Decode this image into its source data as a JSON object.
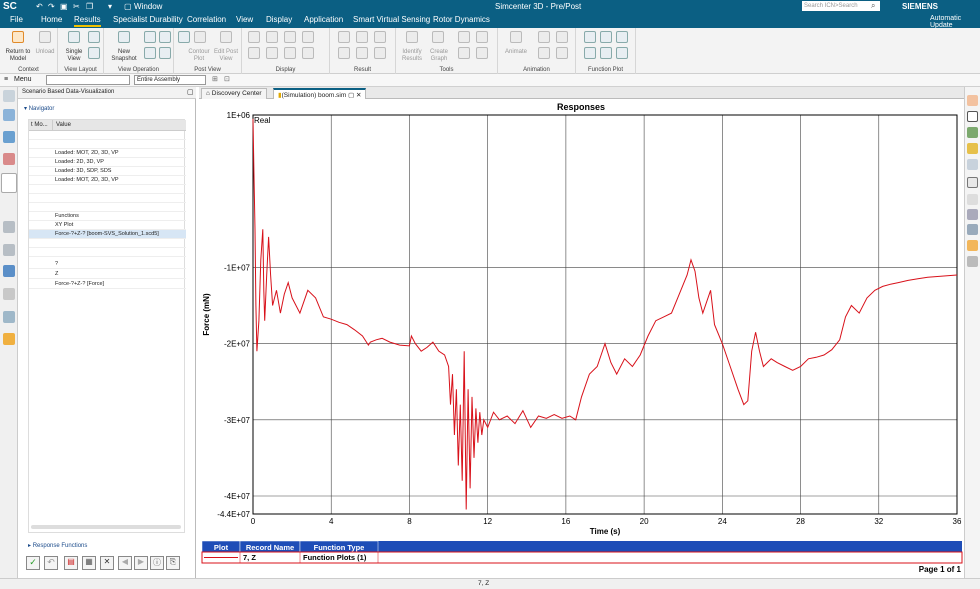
{
  "titlebar": {
    "app_logo": "SC",
    "window_menu": "Window",
    "title": "Simcenter 3D - Pre/Post",
    "search_placeholder": "Search ICN>Search",
    "brand": "SIEMENS",
    "update": "Automatic Update"
  },
  "menubar": {
    "items": [
      "File",
      "Home",
      "Results",
      "Specialist Durability",
      "Correlation",
      "View",
      "Display",
      "Application",
      "Smart Virtual Sensing",
      "Rotor Dynamics"
    ]
  },
  "ribbon": {
    "groups": [
      {
        "label": "Context",
        "buttons": [
          "Return to Model",
          "Unload"
        ]
      },
      {
        "label": "View Layout",
        "buttons": [
          "Single View"
        ]
      },
      {
        "label": "View Operation",
        "buttons": [
          "New Snapshot"
        ]
      },
      {
        "label": "Post View",
        "buttons": [
          "Contour Plot",
          "Edit Post View"
        ]
      },
      {
        "label": "Display",
        "buttons": []
      },
      {
        "label": "Result",
        "buttons": []
      },
      {
        "label": "Tools",
        "buttons": [
          "Identify Results",
          "Create Graph"
        ]
      },
      {
        "label": "Animation",
        "buttons": [
          "Animate"
        ]
      },
      {
        "label": "Function Plot",
        "buttons": []
      }
    ]
  },
  "toolbar2": {
    "menu_label": "Menu",
    "filter_value": "",
    "assembly_value": "Entire Assembly"
  },
  "navigator": {
    "panel_title": "Scenario Based Data-Visualization",
    "section": "Navigator",
    "col1": "t Mo...",
    "col2": "Value",
    "rows": [
      "",
      "",
      "Loaded: MOT, 2D, 3D, VP",
      "Loaded: 2D, 3D, VP",
      "Loaded: 3D, SDP, SDS",
      "Loaded: MOT, 2D, 3D, VP",
      "",
      "",
      "",
      "Functions",
      "XY Plot",
      "Force-?+Z-? [boom-SVS_Solution_1.scd5]",
      "",
      "",
      "?",
      "Z",
      "Force-?+Z-? [Force]"
    ],
    "selected_index": 11,
    "response_functions": "Response Functions"
  },
  "tabs": {
    "discovery": "Discovery Center",
    "sim": "(Simulation) boom.sim"
  },
  "chart_data": {
    "type": "line",
    "title": "Responses",
    "annotation": "Real",
    "xlabel": "Time (s)",
    "ylabel": "Force (mN)",
    "xlim": [
      0,
      36
    ],
    "ylim": [
      -44000000,
      10000000
    ],
    "xticks": [
      0,
      4,
      8,
      12,
      16,
      20,
      24,
      28,
      32,
      36
    ],
    "xtick_labels": [
      "0",
      "4",
      "8",
      "12",
      "16",
      "20",
      "24",
      "28",
      "32",
      "36"
    ],
    "yticks": [
      10000000,
      -10000000,
      -20000000,
      -30000000,
      -40000000,
      -44000000
    ],
    "ytick_labels": [
      "1E+06",
      "-1E+07",
      "-2E+07",
      "-3E+07",
      "-4E+07",
      "-4.4E+07"
    ],
    "grid": true,
    "series_color": "#d8111a",
    "series": [
      {
        "name": "7, Z",
        "points": [
          [
            0,
            9500000
          ],
          [
            0.05,
            2000000
          ],
          [
            0.1,
            -5000000
          ],
          [
            0.15,
            -15000000
          ],
          [
            0.2,
            -21000000
          ],
          [
            0.3,
            -17000000
          ],
          [
            0.4,
            -9000000
          ],
          [
            0.5,
            -5000000
          ],
          [
            0.55,
            -13000000
          ],
          [
            0.6,
            -17000000
          ],
          [
            0.7,
            -11000000
          ],
          [
            0.8,
            -6000000
          ],
          [
            0.9,
            -11000000
          ],
          [
            1.0,
            -15000000
          ],
          [
            1.2,
            -13000000
          ],
          [
            1.4,
            -16000000
          ],
          [
            1.6,
            -13500000
          ],
          [
            1.8,
            -12000000
          ],
          [
            2.0,
            -14000000
          ],
          [
            2.4,
            -16000000
          ],
          [
            2.8,
            -13000000
          ],
          [
            3.2,
            -14000000
          ],
          [
            3.6,
            -16500000
          ],
          [
            4.0,
            -16800000
          ],
          [
            4.4,
            -17200000
          ],
          [
            4.8,
            -17500000
          ],
          [
            5.2,
            -18200000
          ],
          [
            5.6,
            -19000000
          ],
          [
            5.9,
            -20200000
          ],
          [
            6.0,
            -19800000
          ],
          [
            6.3,
            -19500000
          ],
          [
            6.6,
            -19300000
          ],
          [
            7.0,
            -19800000
          ],
          [
            7.5,
            -20200000
          ],
          [
            8.0,
            -20300000
          ],
          [
            8.1,
            -19000000
          ],
          [
            8.3,
            -20000000
          ],
          [
            8.6,
            -21000000
          ],
          [
            8.9,
            -20500000
          ],
          [
            9.2,
            -19800000
          ],
          [
            9.5,
            -21000000
          ],
          [
            9.8,
            -21500000
          ],
          [
            10.0,
            -23000000
          ],
          [
            10.1,
            -28000000
          ],
          [
            10.2,
            -24000000
          ],
          [
            10.3,
            -32000000
          ],
          [
            10.4,
            -26000000
          ],
          [
            10.5,
            -36000000
          ],
          [
            10.6,
            -28000000
          ],
          [
            10.7,
            -38000000
          ],
          [
            10.8,
            -21000000
          ],
          [
            10.9,
            -43000000
          ],
          [
            11.0,
            -26000000
          ],
          [
            11.1,
            -39000000
          ],
          [
            11.2,
            -27000000
          ],
          [
            11.3,
            -35000000
          ],
          [
            11.4,
            -28500000
          ],
          [
            11.5,
            -33000000
          ],
          [
            11.6,
            -29000000
          ],
          [
            11.7,
            -32000000
          ],
          [
            11.8,
            -30000000
          ],
          [
            12.0,
            -31000000
          ],
          [
            12.3,
            -29000000
          ],
          [
            12.6,
            -30000000
          ],
          [
            13.0,
            -29500000
          ],
          [
            13.4,
            -30500000
          ],
          [
            13.8,
            -28800000
          ],
          [
            14.2,
            -31000000
          ],
          [
            14.6,
            -29500000
          ],
          [
            15.0,
            -29800000
          ],
          [
            15.4,
            -29300000
          ],
          [
            15.8,
            -29800000
          ],
          [
            16.2,
            -29500000
          ],
          [
            16.5,
            -30000000
          ],
          [
            16.8,
            -27000000
          ],
          [
            17.2,
            -24000000
          ],
          [
            17.6,
            -23000000
          ],
          [
            18.0,
            -20000000
          ],
          [
            18.3,
            -22500000
          ],
          [
            18.6,
            -24000000
          ],
          [
            19.0,
            -22000000
          ],
          [
            19.4,
            -23000000
          ],
          [
            19.8,
            -21500000
          ],
          [
            20.2,
            -19000000
          ],
          [
            20.6,
            -17000000
          ],
          [
            21.0,
            -16500000
          ],
          [
            21.4,
            -16000000
          ],
          [
            21.8,
            -13500000
          ],
          [
            22.2,
            -11000000
          ],
          [
            22.4,
            -9000000
          ],
          [
            22.6,
            -10500000
          ],
          [
            22.8,
            -14000000
          ],
          [
            23.0,
            -16000000
          ],
          [
            23.2,
            -14500000
          ],
          [
            23.4,
            -13000000
          ],
          [
            23.6,
            -17500000
          ],
          [
            24.0,
            -20000000
          ],
          [
            24.4,
            -23000000
          ],
          [
            24.8,
            -26000000
          ],
          [
            25.1,
            -28000000
          ],
          [
            25.3,
            -27500000
          ],
          [
            25.5,
            -21000000
          ],
          [
            25.7,
            -18500000
          ],
          [
            25.9,
            -21000000
          ],
          [
            26.1,
            -23000000
          ],
          [
            26.3,
            -22500000
          ],
          [
            26.5,
            -22000000
          ],
          [
            26.8,
            -22500000
          ],
          [
            27.2,
            -23000000
          ],
          [
            27.6,
            -23500000
          ],
          [
            28.0,
            -23000000
          ],
          [
            28.4,
            -22000000
          ],
          [
            28.8,
            -21800000
          ],
          [
            29.2,
            -21500000
          ],
          [
            29.6,
            -20800000
          ],
          [
            30.0,
            -19500000
          ],
          [
            30.3,
            -16500000
          ],
          [
            30.6,
            -15000000
          ],
          [
            31.0,
            -16000000
          ],
          [
            31.4,
            -14000000
          ],
          [
            31.8,
            -13000000
          ],
          [
            32.2,
            -12500000
          ],
          [
            32.6,
            -12200000
          ],
          [
            33.0,
            -12000000
          ],
          [
            33.5,
            -11700000
          ],
          [
            34.0,
            -11500000
          ],
          [
            34.5,
            -11300000
          ],
          [
            35.0,
            -11200000
          ],
          [
            35.5,
            -11100000
          ],
          [
            36.0,
            -11000000
          ]
        ]
      }
    ],
    "legend_table": {
      "headers": [
        "Plot",
        "Record Name",
        "Function Type"
      ],
      "rows": [
        [
          "7, Z",
          "Function Plots (1)"
        ]
      ]
    },
    "page_label": "Page 1 of 1"
  },
  "statusbar": {
    "text": "7, Z"
  },
  "colors": {
    "accent": "#0b5f83",
    "legend_header": "#1e4db7",
    "series": "#d8111a"
  }
}
